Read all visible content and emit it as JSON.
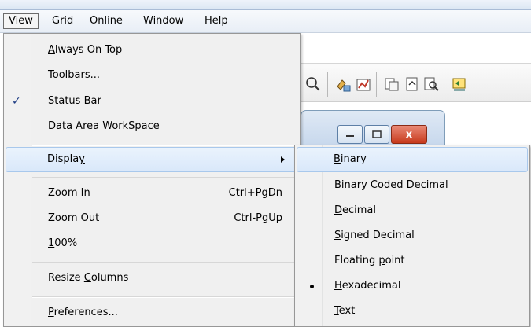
{
  "menubar": {
    "items": [
      "View",
      "Grid",
      "Online",
      "Window",
      "Help"
    ]
  },
  "view_menu": {
    "items": [
      {
        "pre": "",
        "acc": "A",
        "post": "lways On Top",
        "shortcut": "",
        "checked": false
      },
      {
        "pre": "",
        "acc": "T",
        "post": "oolbars...",
        "shortcut": "",
        "checked": false
      },
      {
        "pre": "",
        "acc": "S",
        "post": "tatus Bar",
        "shortcut": "",
        "checked": true
      },
      {
        "pre": "",
        "acc": "D",
        "post": "ata Area WorkSpace",
        "shortcut": "",
        "checked": false
      },
      {
        "pre": "Displa",
        "acc": "y",
        "post": "",
        "shortcut": "",
        "checked": false,
        "submenu": true
      },
      {
        "pre": "Zoom ",
        "acc": "I",
        "post": "n",
        "shortcut": "Ctrl+PgDn"
      },
      {
        "pre": "Zoom ",
        "acc": "O",
        "post": "ut",
        "shortcut": "Ctrl-PgUp"
      },
      {
        "pre": "",
        "acc": "1",
        "post": "00%",
        "shortcut": ""
      },
      {
        "pre": "Resize ",
        "acc": "C",
        "post": "olumns",
        "shortcut": ""
      },
      {
        "pre": "",
        "acc": "P",
        "post": "references...",
        "shortcut": ""
      }
    ]
  },
  "display_menu": {
    "items": [
      {
        "pre": "",
        "acc": "B",
        "post": "inary",
        "selected": false
      },
      {
        "pre": "Binary ",
        "acc": "C",
        "post": "oded Decimal",
        "selected": false
      },
      {
        "pre": "",
        "acc": "D",
        "post": "ecimal",
        "selected": false
      },
      {
        "pre": "",
        "acc": "S",
        "post": "igned Decimal",
        "selected": false
      },
      {
        "pre": "Floating ",
        "acc": "p",
        "post": "oint",
        "selected": false
      },
      {
        "pre": "",
        "acc": "H",
        "post": "exadecimal",
        "selected": true
      },
      {
        "pre": "",
        "acc": "T",
        "post": "ext",
        "selected": false
      }
    ]
  },
  "toolbar": {
    "icons": [
      "zoom-icon",
      "probe-icon",
      "chart-icon",
      "copy-icon",
      "export-icon",
      "find-icon",
      "settings-icon"
    ]
  },
  "child_window": {
    "buttons": [
      "minimize",
      "restore",
      "close"
    ],
    "close_glyph": "x"
  }
}
